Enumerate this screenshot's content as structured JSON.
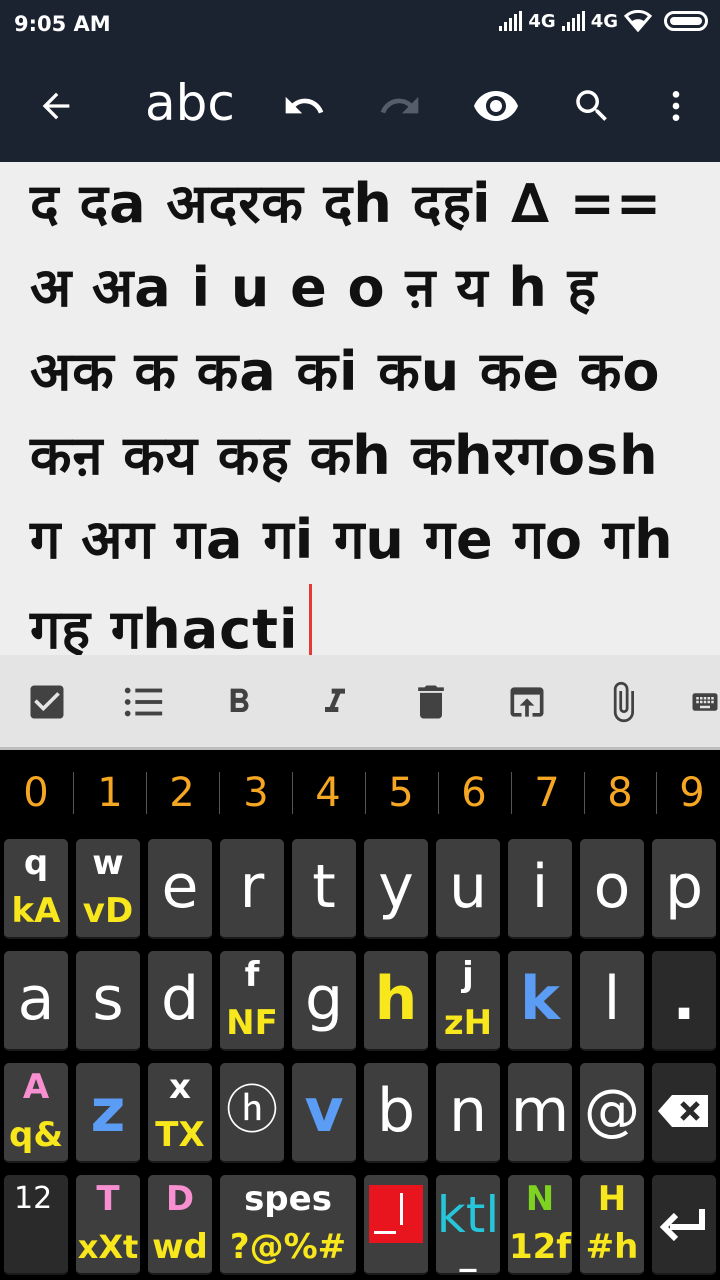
{
  "status": {
    "time": "9:05 AM",
    "net1": "4G",
    "net2": "4G"
  },
  "toolbar": {
    "title": "abc"
  },
  "editor": {
    "lines": [
      "द दa अदरक दh दहi ∆ ==",
      "अ अa i u e o ऩ य h ह",
      "अक क कa कi कu कe कo",
      "कऩ कय कह कh कhरगosh",
      "ग अग गa गi गu गe गo गh",
      "गह गhacti"
    ]
  },
  "numbers": [
    "0",
    "1",
    "2",
    "3",
    "4",
    "5",
    "6",
    "7",
    "8",
    "9"
  ],
  "keyboard": {
    "row1": [
      {
        "top": "q",
        "bot": "kA"
      },
      {
        "top": "w",
        "bot": "vD"
      },
      {
        "main": "e"
      },
      {
        "main": "r"
      },
      {
        "main": "t"
      },
      {
        "main": "y"
      },
      {
        "main": "u"
      },
      {
        "main": "i"
      },
      {
        "main": "o"
      },
      {
        "main": "p"
      }
    ],
    "row2": [
      {
        "main": "a"
      },
      {
        "main": "s"
      },
      {
        "main": "d"
      },
      {
        "top": "f",
        "bot": "NF"
      },
      {
        "main": "g"
      },
      {
        "main": "h"
      },
      {
        "top": "j",
        "bot": "zH"
      },
      {
        "main": "k"
      },
      {
        "main": "l"
      },
      {
        "main": "."
      }
    ],
    "row3": [
      {
        "top": "A",
        "bot": "q&"
      },
      {
        "main": "z"
      },
      {
        "top": "x",
        "bot": "TX"
      },
      {
        "main": "ⓗ"
      },
      {
        "main": "v"
      },
      {
        "main": "b"
      },
      {
        "main": "n"
      },
      {
        "main": "m"
      },
      {
        "main": "@"
      }
    ],
    "row4": {
      "k12": "12",
      "t": {
        "top": "T",
        "bot": "xXt"
      },
      "d": {
        "top": "D",
        "bot": "wd"
      },
      "space": {
        "top": "spes",
        "bot": "?@%#"
      },
      "ktl": {
        "top": "ktl",
        "bot": "_"
      },
      "n": {
        "top": "N",
        "bot": "12f"
      },
      "h": {
        "top": "H",
        "bot": "#h"
      }
    }
  },
  "colors": {
    "toolbar_bg": "#1b2230",
    "editor_bg": "#eeeeee",
    "number_color": "#f5a623",
    "key_bg": "#3e3e3e",
    "accent_yellow": "#f8e71c",
    "accent_pink": "#f78fd0",
    "accent_blue": "#5b9cf5",
    "accent_green": "#7ed321",
    "accent_cyan": "#26c6da",
    "cursor": "#e53935"
  }
}
